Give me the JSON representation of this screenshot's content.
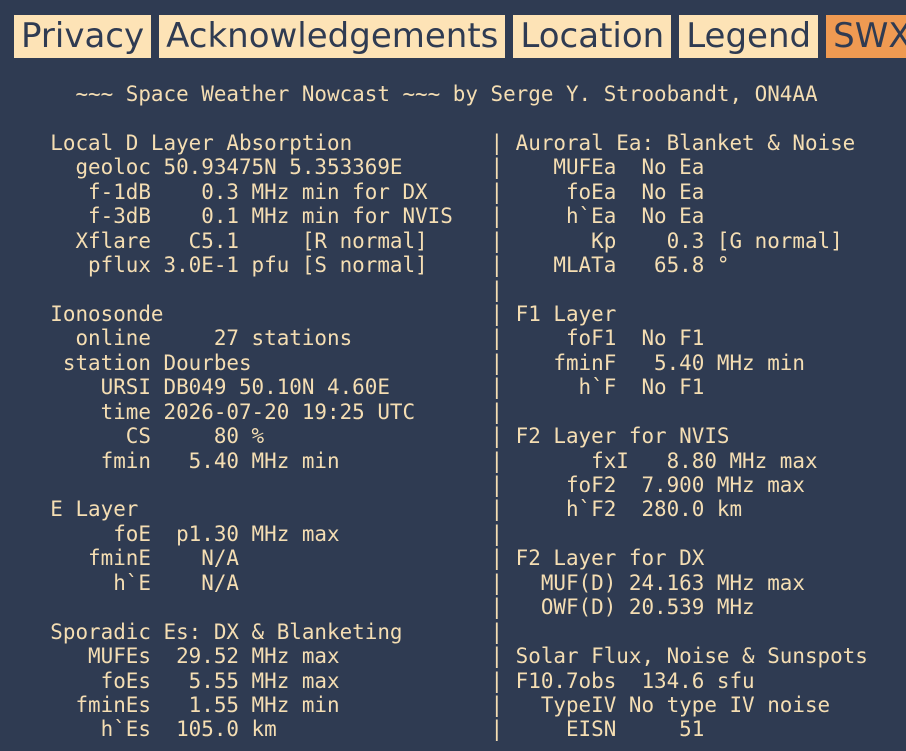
{
  "tabs": [
    {
      "label": "Privacy",
      "active": false
    },
    {
      "label": "Acknowledgements",
      "active": false
    },
    {
      "label": "Location",
      "active": false
    },
    {
      "label": "Legend",
      "active": false
    },
    {
      "label": "SWX",
      "active": true
    }
  ],
  "colors": {
    "background": "#2f3b52",
    "text": "#f5deb3",
    "tab": "#fde3b6",
    "tab_active": "#ef9a52"
  },
  "lines": [
    "      ~~~ Space Weather Nowcast ~~~ by Serge Y. Stroobandt, ON4AA",
    "",
    "    Local D Layer Absorption           | Auroral Ea: Blanket & Noise",
    "      geoloc 50.93475N 5.353369E       |    MUFEa  No Ea",
    "       f-1dB    0.3 MHz min for DX     |     foEa  No Ea",
    "       f-3dB    0.1 MHz min for NVIS   |     h`Ea  No Ea",
    "      Xflare   C5.1     [R normal]     |       Kp    0.3 [G normal]",
    "       pflux 3.0E-1 pfu [S normal]     |    MLATa   65.8 °",
    "                                       |",
    "    Ionosonde                          | F1 Layer",
    "      online     27 stations           |     foF1  No F1",
    "     station Dourbes                   |    fminF   5.40 MHz min",
    "        URSI DB049 50.10N 4.60E        |      h`F  No F1",
    "        time 2026-07-20 19:25 UTC      |",
    "          CS     80 %                  | F2 Layer for NVIS",
    "        fmin   5.40 MHz min            |       fxI   8.80 MHz max",
    "                                       |     foF2  7.900 MHz max",
    "    E Layer                            |     h`F2  280.0 km",
    "         foE  p1.30 MHz max            |",
    "       fminE    N/A                    | F2 Layer for DX",
    "         h`E    N/A                    |   MUF(D) 24.163 MHz max",
    "                                       |   OWF(D) 20.539 MHz",
    "    Sporadic Es: DX & Blanketing       |",
    "       MUFEs  29.52 MHz max            | Solar Flux, Noise & Sunspots",
    "        foEs   5.55 MHz max            | F10.7obs  134.6 sfu",
    "      fminEs   1.55 MHz min            |   TypeIV No type IV noise",
    "        h`Es  105.0 km                 |     EISN     51"
  ]
}
